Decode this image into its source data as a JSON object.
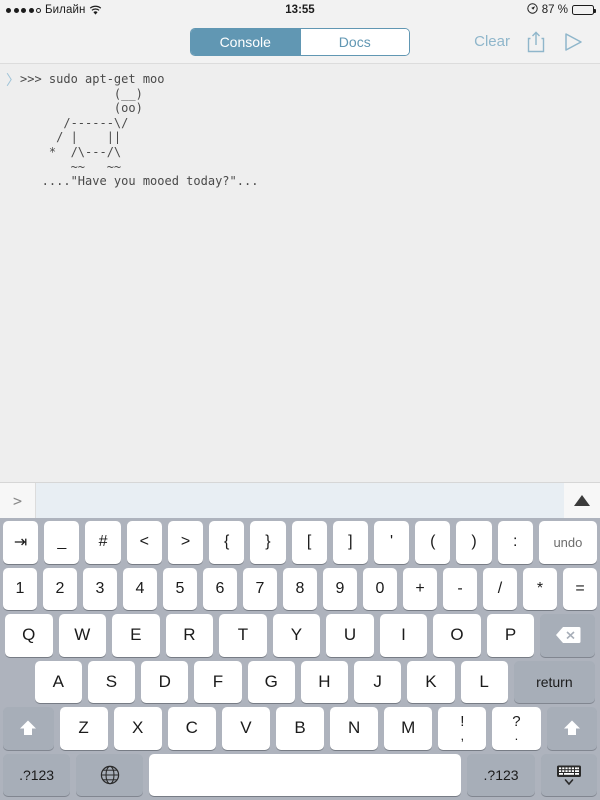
{
  "status_bar": {
    "signal_dots_filled": 4,
    "signal_dots_total": 5,
    "carrier": "Билайн",
    "wifi_icon": "wifi-icon",
    "time": "13:55",
    "location_icon": "location-arrow-icon",
    "battery_percent": "87 %",
    "battery_level": 87
  },
  "toolbar": {
    "segments": [
      {
        "label": "Console",
        "selected": true
      },
      {
        "label": "Docs",
        "selected": false
      }
    ],
    "clear_label": "Clear",
    "share_icon": "share-icon",
    "run_icon": "play-icon",
    "accent_color": "#6197b3"
  },
  "console": {
    "prompt_marker": "〉",
    "output": ">>> sudo apt-get moo\n             (__)\n             (oo)\n      /------\\/\n     / |    ||\n    *  /\\---/\\\n       ~~   ~~\n   ....\"Have you mooed today?\"..."
  },
  "input_bar": {
    "prompt": ">",
    "value": "",
    "placeholder": "",
    "history_up_icon": "triangle-up-icon"
  },
  "keyboard": {
    "rows": [
      {
        "name": "symbols",
        "keys": [
          {
            "label": "⇥",
            "name": "tab-key",
            "style": "white"
          },
          {
            "label": "_",
            "name": "underscore-key",
            "style": "white"
          },
          {
            "label": "#",
            "name": "hash-key",
            "style": "white"
          },
          {
            "label": "<",
            "name": "less-than-key",
            "style": "white"
          },
          {
            "label": ">",
            "name": "greater-than-key",
            "style": "white"
          },
          {
            "label": "{",
            "name": "left-brace-key",
            "style": "white"
          },
          {
            "label": "}",
            "name": "right-brace-key",
            "style": "white"
          },
          {
            "label": "[",
            "name": "left-bracket-key",
            "style": "white"
          },
          {
            "label": "]",
            "name": "right-bracket-key",
            "style": "white"
          },
          {
            "label": "'",
            "name": "apostrophe-key",
            "style": "white"
          },
          {
            "label": "(",
            "name": "left-paren-key",
            "style": "white"
          },
          {
            "label": ")",
            "name": "right-paren-key",
            "style": "white"
          },
          {
            "label": ":",
            "name": "colon-key",
            "style": "white"
          },
          {
            "label": "undo",
            "name": "undo-key",
            "style": "white-wide"
          }
        ]
      },
      {
        "name": "numbers",
        "keys": [
          {
            "label": "1",
            "name": "key-1"
          },
          {
            "label": "2",
            "name": "key-2"
          },
          {
            "label": "3",
            "name": "key-3"
          },
          {
            "label": "4",
            "name": "key-4"
          },
          {
            "label": "5",
            "name": "key-5"
          },
          {
            "label": "6",
            "name": "key-6"
          },
          {
            "label": "7",
            "name": "key-7"
          },
          {
            "label": "8",
            "name": "key-8"
          },
          {
            "label": "9",
            "name": "key-9"
          },
          {
            "label": "0",
            "name": "key-0"
          },
          {
            "label": "+",
            "name": "plus-key"
          },
          {
            "label": "-",
            "name": "minus-key"
          },
          {
            "label": "/",
            "name": "slash-key"
          },
          {
            "label": "*",
            "name": "asterisk-key"
          },
          {
            "label": "=",
            "name": "equals-key"
          }
        ]
      },
      {
        "name": "qwerty",
        "keys": [
          {
            "label": "Q",
            "name": "key-q"
          },
          {
            "label": "W",
            "name": "key-w"
          },
          {
            "label": "E",
            "name": "key-e"
          },
          {
            "label": "R",
            "name": "key-r"
          },
          {
            "label": "T",
            "name": "key-t"
          },
          {
            "label": "Y",
            "name": "key-y"
          },
          {
            "label": "U",
            "name": "key-u"
          },
          {
            "label": "I",
            "name": "key-i"
          },
          {
            "label": "O",
            "name": "key-o"
          },
          {
            "label": "P",
            "name": "key-p"
          },
          {
            "label": "",
            "name": "backspace-key",
            "icon": "backspace-icon"
          }
        ]
      },
      {
        "name": "asdf",
        "keys": [
          {
            "label": "A",
            "name": "key-a"
          },
          {
            "label": "S",
            "name": "key-s"
          },
          {
            "label": "D",
            "name": "key-d"
          },
          {
            "label": "F",
            "name": "key-f"
          },
          {
            "label": "G",
            "name": "key-g"
          },
          {
            "label": "H",
            "name": "key-h"
          },
          {
            "label": "J",
            "name": "key-j"
          },
          {
            "label": "K",
            "name": "key-k"
          },
          {
            "label": "L",
            "name": "key-l"
          },
          {
            "label": "return",
            "name": "return-key"
          }
        ]
      },
      {
        "name": "zxcv",
        "keys": [
          {
            "label": "",
            "name": "shift-left-key",
            "icon": "shift-icon"
          },
          {
            "label": "Z",
            "name": "key-z"
          },
          {
            "label": "X",
            "name": "key-x"
          },
          {
            "label": "C",
            "name": "key-c"
          },
          {
            "label": "V",
            "name": "key-v"
          },
          {
            "label": "B",
            "name": "key-b"
          },
          {
            "label": "N",
            "name": "key-n"
          },
          {
            "label": "M",
            "name": "key-m"
          },
          {
            "top": "!",
            "bottom": ",",
            "name": "exclamation-comma-key"
          },
          {
            "top": "?",
            "bottom": ".",
            "name": "question-period-key"
          },
          {
            "label": "",
            "name": "shift-right-key",
            "icon": "shift-icon"
          }
        ]
      },
      {
        "name": "bottom",
        "keys": [
          {
            "label": ".?123",
            "name": "numeric-mode-left-key"
          },
          {
            "label": "",
            "name": "globe-key",
            "icon": "globe-icon"
          },
          {
            "label": "",
            "name": "space-key"
          },
          {
            "label": ".?123",
            "name": "numeric-mode-right-key"
          },
          {
            "label": "",
            "name": "hide-keyboard-key",
            "icon": "hide-keyboard-icon"
          }
        ]
      }
    ]
  }
}
